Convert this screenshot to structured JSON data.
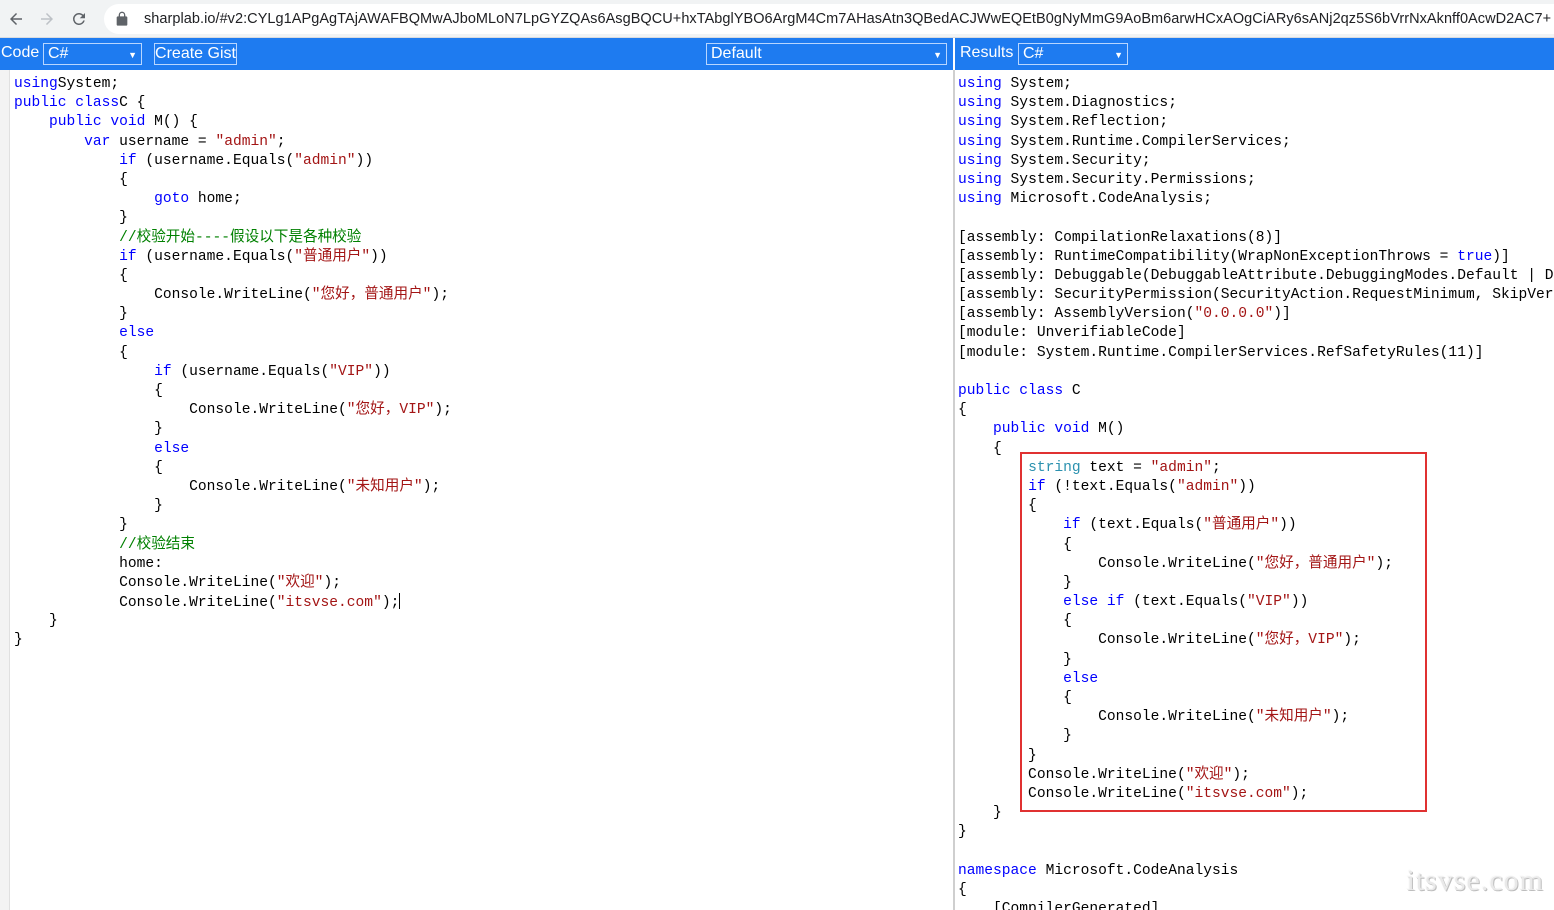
{
  "browser": {
    "url": "sharplab.io/#v2:CYLg1APgAgTAjAWAFBQMwAJboMLoN7LpGYZQAs6AsgBQCU+hxTAbglYBO6ArgM4Cm7AHasAtn3QBedACJWwEQEtB0gNyMmG9AoBm6arwHCxAOgCiARy6sANj2qz5S6bVrrNxAknff0AcwD2AC7+"
  },
  "code_panel": {
    "label": "Code",
    "language": "C#",
    "create_gist": "Create Gist",
    "mode": "Default"
  },
  "results_panel": {
    "label": "Results",
    "language": "C#"
  },
  "source_lines": [
    [
      [
        "kw",
        "using"
      ],
      [
        "",
        "System;"
      ]
    ],
    [
      [
        "kw",
        "public class"
      ],
      [
        "",
        "C {"
      ]
    ],
    [
      [
        "",
        "    "
      ],
      [
        "kw",
        "public void"
      ],
      [
        "",
        " M() {"
      ]
    ],
    [
      [
        "",
        "        "
      ],
      [
        "kw",
        "var"
      ],
      [
        "",
        " username = "
      ],
      [
        "str",
        "\"admin\""
      ],
      [
        "",
        ";"
      ]
    ],
    [
      [
        "",
        "            "
      ],
      [
        "kw",
        "if"
      ],
      [
        "",
        " (username.Equals("
      ],
      [
        "str",
        "\"admin\""
      ],
      [
        "",
        "))"
      ]
    ],
    [
      [
        "",
        "            {"
      ]
    ],
    [
      [
        "",
        "                "
      ],
      [
        "kw",
        "goto"
      ],
      [
        "",
        " home;"
      ]
    ],
    [
      [
        "",
        "            }"
      ]
    ],
    [
      [
        "",
        "            "
      ],
      [
        "cm",
        "//校验开始----假设以下是各种校验"
      ]
    ],
    [
      [
        "",
        "            "
      ],
      [
        "kw",
        "if"
      ],
      [
        "",
        " (username.Equals("
      ],
      [
        "str",
        "\"普通用户\""
      ],
      [
        "",
        "))"
      ]
    ],
    [
      [
        "",
        "            {"
      ]
    ],
    [
      [
        "",
        "                Console.WriteLine("
      ],
      [
        "str",
        "\"您好，普通用户\""
      ],
      [
        "",
        ");"
      ]
    ],
    [
      [
        "",
        "            }"
      ]
    ],
    [
      [
        "",
        "            "
      ],
      [
        "kw",
        "else"
      ]
    ],
    [
      [
        "",
        "            {"
      ]
    ],
    [
      [
        "",
        "                "
      ],
      [
        "kw",
        "if"
      ],
      [
        "",
        " (username.Equals("
      ],
      [
        "str",
        "\"VIP\""
      ],
      [
        "",
        "))"
      ]
    ],
    [
      [
        "",
        "                {"
      ]
    ],
    [
      [
        "",
        "                    Console.WriteLine("
      ],
      [
        "str",
        "\"您好，VIP\""
      ],
      [
        "",
        ");"
      ]
    ],
    [
      [
        "",
        "                }"
      ]
    ],
    [
      [
        "",
        "                "
      ],
      [
        "kw",
        "else"
      ]
    ],
    [
      [
        "",
        "                {"
      ]
    ],
    [
      [
        "",
        "                    Console.WriteLine("
      ],
      [
        "str",
        "\"未知用户\""
      ],
      [
        "",
        ");"
      ]
    ],
    [
      [
        "",
        "                }"
      ]
    ],
    [
      [
        "",
        "            }"
      ]
    ],
    [
      [
        "",
        "            "
      ],
      [
        "cm",
        "//校验结束"
      ]
    ],
    [
      [
        "",
        "            home:"
      ]
    ],
    [
      [
        "",
        "            Console.WriteLine("
      ],
      [
        "str",
        "\"欢迎\""
      ],
      [
        "",
        ");"
      ]
    ],
    [
      [
        "",
        "            Console.WriteLine("
      ],
      [
        "str",
        "\"itsvse.com\""
      ],
      [
        "",
        ");"
      ],
      [
        "cursor",
        ""
      ]
    ],
    [
      [
        "",
        "    }"
      ]
    ],
    [
      [
        "",
        "}"
      ]
    ]
  ],
  "result_lines": [
    [
      [
        "kw",
        "using"
      ],
      [
        "",
        " System;"
      ]
    ],
    [
      [
        "kw",
        "using"
      ],
      [
        "",
        " System.Diagnostics;"
      ]
    ],
    [
      [
        "kw",
        "using"
      ],
      [
        "",
        " System.Reflection;"
      ]
    ],
    [
      [
        "kw",
        "using"
      ],
      [
        "",
        " System.Runtime.CompilerServices;"
      ]
    ],
    [
      [
        "kw",
        "using"
      ],
      [
        "",
        " System.Security;"
      ]
    ],
    [
      [
        "kw",
        "using"
      ],
      [
        "",
        " System.Security.Permissions;"
      ]
    ],
    [
      [
        "kw",
        "using"
      ],
      [
        "",
        " Microsoft.CodeAnalysis;"
      ]
    ],
    [
      [
        "",
        ""
      ]
    ],
    [
      [
        "",
        "[assembly: CompilationRelaxations(8)]"
      ]
    ],
    [
      [
        "",
        "[assembly: RuntimeCompatibility(WrapNonExceptionThrows = "
      ],
      [
        "kw",
        "true"
      ],
      [
        "",
        ")]"
      ]
    ],
    [
      [
        "",
        "[assembly: Debuggable(DebuggableAttribute.DebuggingModes.Default | D"
      ]
    ],
    [
      [
        "",
        "[assembly: SecurityPermission(SecurityAction.RequestMinimum, SkipVer"
      ]
    ],
    [
      [
        "",
        "[assembly: AssemblyVersion("
      ],
      [
        "str",
        "\"0.0.0.0\""
      ],
      [
        "",
        ")]"
      ]
    ],
    [
      [
        "",
        "[module: UnverifiableCode]"
      ]
    ],
    [
      [
        "",
        "[module: System.Runtime.CompilerServices.RefSafetyRules(11)]"
      ]
    ],
    [
      [
        "",
        ""
      ]
    ],
    [
      [
        "kw",
        "public class"
      ],
      [
        "",
        " C"
      ]
    ],
    [
      [
        "",
        "{"
      ]
    ],
    [
      [
        "",
        "    "
      ],
      [
        "kw",
        "public void"
      ],
      [
        "",
        " M()"
      ]
    ],
    [
      [
        "",
        "    {"
      ]
    ],
    [
      [
        "",
        "        "
      ],
      [
        "ty",
        "string"
      ],
      [
        "",
        " text = "
      ],
      [
        "str",
        "\"admin\""
      ],
      [
        "",
        ";"
      ]
    ],
    [
      [
        "",
        "        "
      ],
      [
        "kw",
        "if"
      ],
      [
        "",
        " (!text.Equals("
      ],
      [
        "str",
        "\"admin\""
      ],
      [
        "",
        "))"
      ]
    ],
    [
      [
        "",
        "        {"
      ]
    ],
    [
      [
        "",
        "            "
      ],
      [
        "kw",
        "if"
      ],
      [
        "",
        " (text.Equals("
      ],
      [
        "str",
        "\"普通用户\""
      ],
      [
        "",
        "))"
      ]
    ],
    [
      [
        "",
        "            {"
      ]
    ],
    [
      [
        "",
        "                Console.WriteLine("
      ],
      [
        "str",
        "\"您好，普通用户\""
      ],
      [
        "",
        ");"
      ]
    ],
    [
      [
        "",
        "            }"
      ]
    ],
    [
      [
        "",
        "            "
      ],
      [
        "kw",
        "else if"
      ],
      [
        "",
        " (text.Equals("
      ],
      [
        "str",
        "\"VIP\""
      ],
      [
        "",
        "))"
      ]
    ],
    [
      [
        "",
        "            {"
      ]
    ],
    [
      [
        "",
        "                Console.WriteLine("
      ],
      [
        "str",
        "\"您好，VIP\""
      ],
      [
        "",
        ");"
      ]
    ],
    [
      [
        "",
        "            }"
      ]
    ],
    [
      [
        "",
        "            "
      ],
      [
        "kw",
        "else"
      ]
    ],
    [
      [
        "",
        "            {"
      ]
    ],
    [
      [
        "",
        "                Console.WriteLine("
      ],
      [
        "str",
        "\"未知用户\""
      ],
      [
        "",
        ");"
      ]
    ],
    [
      [
        "",
        "            }"
      ]
    ],
    [
      [
        "",
        "        }"
      ]
    ],
    [
      [
        "",
        "        Console.WriteLine("
      ],
      [
        "str",
        "\"欢迎\""
      ],
      [
        "",
        ");"
      ]
    ],
    [
      [
        "",
        "        Console.WriteLine("
      ],
      [
        "str",
        "\"itsvse.com\""
      ],
      [
        "",
        ");"
      ]
    ],
    [
      [
        "",
        "    }"
      ]
    ],
    [
      [
        "",
        "}"
      ]
    ],
    [
      [
        "",
        ""
      ]
    ],
    [
      [
        "kw",
        "namespace"
      ],
      [
        "",
        " Microsoft.CodeAnalysis"
      ]
    ],
    [
      [
        "",
        "{"
      ]
    ],
    [
      [
        "",
        "    [CompilerGenerated]"
      ]
    ]
  ],
  "watermark": "itsvse.com"
}
